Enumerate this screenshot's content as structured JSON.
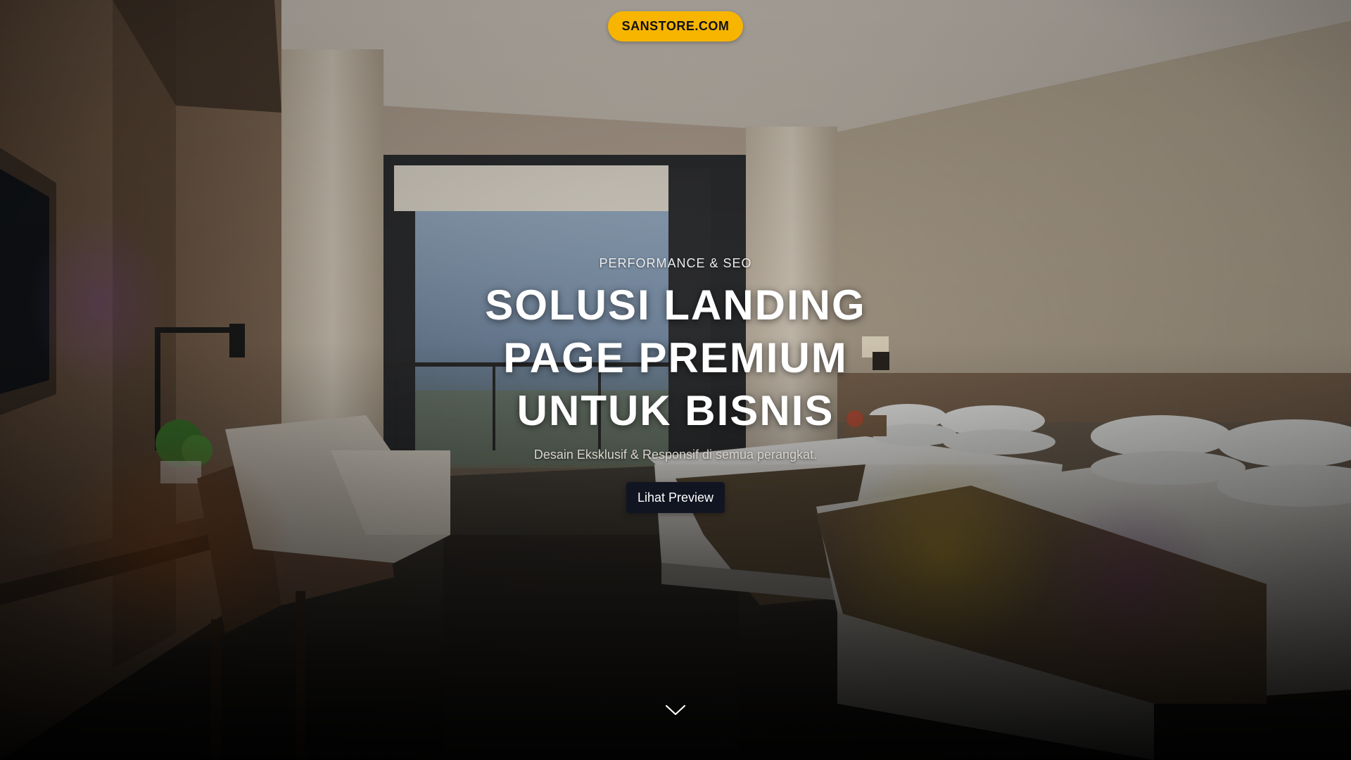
{
  "brand": {
    "label": "SANSTORE.COM",
    "color": "#f7b500"
  },
  "hero": {
    "eyebrow": "PERFORMANCE & SEO",
    "headline_lines": [
      "SOLUSI LANDING",
      "PAGE PREMIUM",
      "UNTUK BISNIS"
    ],
    "subtitle": "Desain Eksklusif & Responsif di semua perangkat.",
    "cta_label": "Lihat Preview",
    "cta_color": "#111522"
  },
  "background": {
    "description_icon": "hotel-room-photo"
  },
  "scroll_indicator": {
    "icon": "chevron-down-icon"
  }
}
